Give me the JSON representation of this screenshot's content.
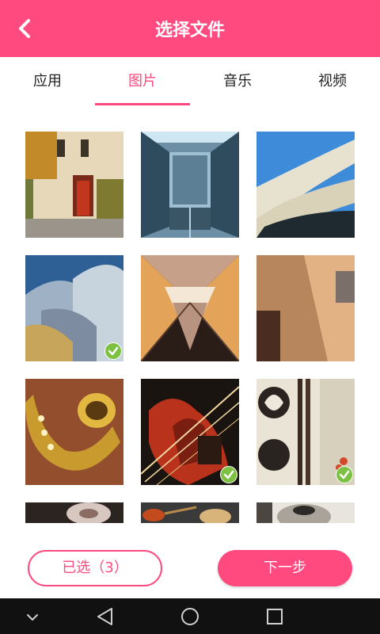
{
  "header": {
    "title": "选择文件",
    "back_icon": "chevron-left-icon",
    "bg_color": "#fe4a7e"
  },
  "tabs": [
    {
      "label": "应用",
      "active": false
    },
    {
      "label": "图片",
      "active": true
    },
    {
      "label": "音乐",
      "active": false
    },
    {
      "label": "视频",
      "active": false
    }
  ],
  "gallery": {
    "items": [
      {
        "subject": "building-with-red-door",
        "selected": false
      },
      {
        "subject": "glass-corridor",
        "selected": false
      },
      {
        "subject": "curved-balconies",
        "selected": false
      },
      {
        "subject": "metal-architecture",
        "selected": true
      },
      {
        "subject": "symmetric-stairs",
        "selected": false
      },
      {
        "subject": "building-corner",
        "selected": false
      },
      {
        "subject": "saxophone",
        "selected": false
      },
      {
        "subject": "violin",
        "selected": true
      },
      {
        "subject": "stones-and-chopsticks",
        "selected": true
      },
      {
        "subject": "food-bowl",
        "selected": false
      },
      {
        "subject": "spoon-with-spice",
        "selected": false
      },
      {
        "subject": "metal-teapot",
        "selected": false
      }
    ]
  },
  "footer": {
    "selected_label": "已选（3）",
    "next_label": "下一步"
  },
  "system_nav": {
    "icons": [
      "chevron-down-icon",
      "back-triangle-icon",
      "home-circle-icon",
      "recents-square-icon"
    ]
  },
  "colors": {
    "accent": "#fe4a7e",
    "check": "#7dc142"
  }
}
